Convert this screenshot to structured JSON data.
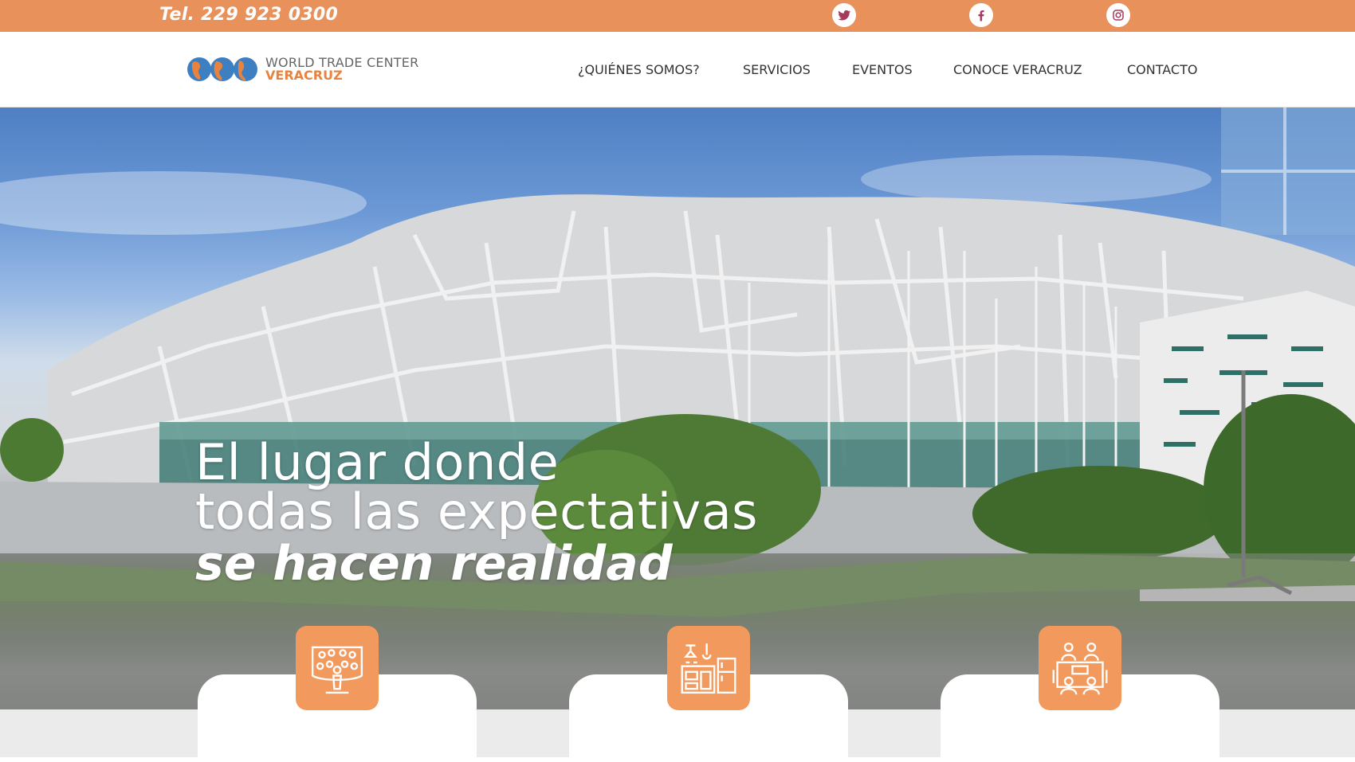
{
  "topbar": {
    "phone": "Tel. 229 923 0300",
    "social": [
      "twitter-icon",
      "facebook-icon",
      "instagram-icon"
    ],
    "bg_color": "#E8915A"
  },
  "brand": {
    "line1": "WORLD TRADE CENTER",
    "line2": "VERACRUZ",
    "accent_color": "#E8833F"
  },
  "nav": {
    "items": [
      {
        "label": "¿QUIÉNES SOMOS?"
      },
      {
        "label": "SERVICIOS"
      },
      {
        "label": "EVENTOS"
      },
      {
        "label": "CONOCE VERACRUZ"
      },
      {
        "label": "CONTACTO"
      }
    ]
  },
  "hero": {
    "line1": "El lugar donde",
    "line2": "todas las expectativas",
    "line3": "se hacen realidad"
  },
  "feature_icons": [
    "auditorium-icon",
    "kitchen-icon",
    "meeting-icon"
  ]
}
